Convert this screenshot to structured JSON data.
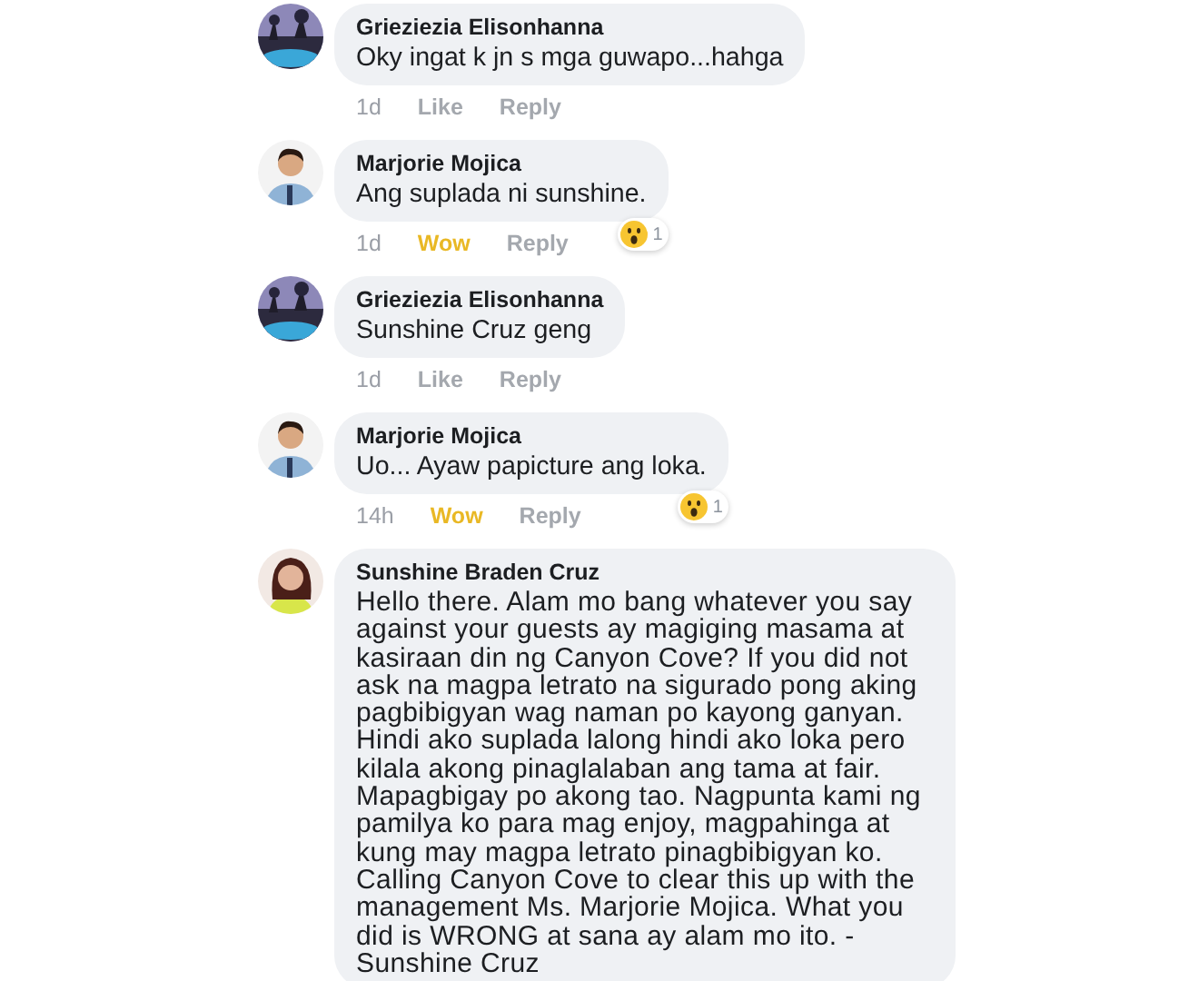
{
  "comments": [
    {
      "author": "Grieziezia Elisonhanna",
      "text": "Oky ingat k jn s mga guwapo...hahga",
      "time": "1d",
      "react_label": "Like",
      "reacted": false,
      "reply_label": "Reply"
    },
    {
      "author": "Marjorie Mojica",
      "text": "Ang suplada ni sunshine.",
      "time": "1d",
      "react_label": "Wow",
      "reacted": true,
      "reply_label": "Reply",
      "reaction_count": "1"
    },
    {
      "author": "Grieziezia Elisonhanna",
      "text": "Sunshine Cruz geng",
      "time": "1d",
      "react_label": "Like",
      "reacted": false,
      "reply_label": "Reply"
    },
    {
      "author": "Marjorie Mojica",
      "text": "Uo... Ayaw papicture ang loka.",
      "time": "14h",
      "react_label": "Wow",
      "reacted": true,
      "reply_label": "Reply",
      "reaction_count": "1"
    },
    {
      "author": "Sunshine Braden Cruz",
      "text": "Hello there. Alam mo bang whatever you say against your guests ay magiging masama at kasiraan din ng Canyon Cove? If you did not ask na magpa letrato na sigurado pong aking pagbibigyan wag naman po kayong ganyan. Hindi ako suplada lalong hindi ako loka pero kilala akong pinaglalaban ang tama at fair. Mapagbigay po akong tao. Nagpunta kami ng pamilya ko para mag enjoy, magpahinga at kung may magpa letrato pinagbibigyan ko. Calling Canyon Cove to clear this up with the management Ms. Marjorie Mojica. What you did is WRONG at sana ay alam mo ito. - Sunshine Cruz"
    }
  ]
}
